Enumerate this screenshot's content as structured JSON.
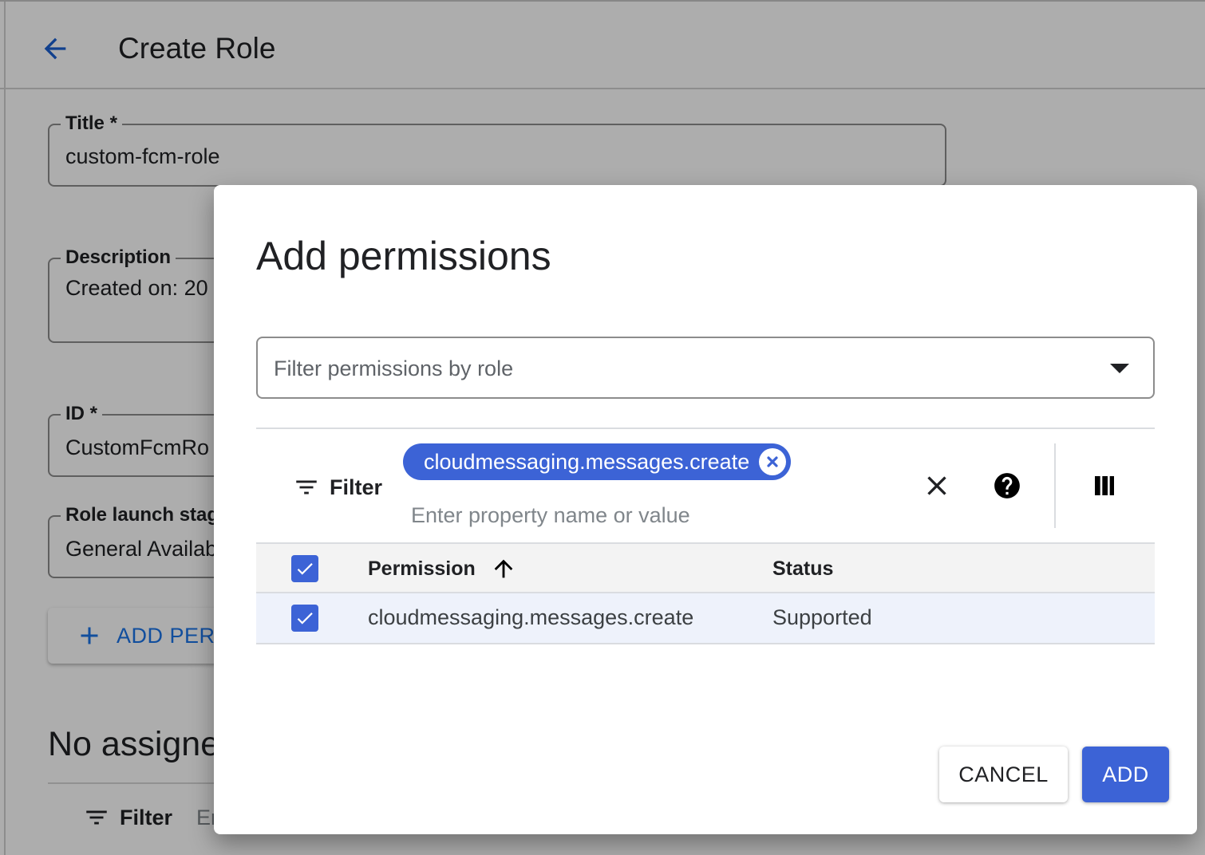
{
  "page": {
    "title": "Create Role",
    "fields": {
      "title": {
        "label": "Title *",
        "value": "custom-fcm-role"
      },
      "description": {
        "label": "Description",
        "value": "Created on: 20"
      },
      "id": {
        "label": "ID *",
        "value": "CustomFcmRo"
      },
      "launch_stage": {
        "label": "Role launch stag",
        "value": "General Availab"
      }
    },
    "add_permissions_label": "ADD PERI",
    "no_assigned_heading": "No assigne",
    "filter": {
      "label": "Filter",
      "placeholder": "Er"
    }
  },
  "dialog": {
    "title": "Add permissions",
    "role_filter_placeholder": "Filter permissions by role",
    "filterbar": {
      "label": "Filter",
      "chip": "cloudmessaging.messages.create",
      "input_placeholder": "Enter property name or value"
    },
    "table": {
      "columns": {
        "permission": "Permission",
        "status": "Status"
      },
      "sort": "ascending",
      "rows": [
        {
          "permission": "cloudmessaging.messages.create",
          "status": "Supported",
          "checked": true
        }
      ],
      "header_checked": true
    },
    "buttons": {
      "cancel": "CANCEL",
      "add": "ADD"
    }
  },
  "colors": {
    "primary": "#3c63d6",
    "link": "#1a73e8",
    "row_selected": "#eef2fb",
    "scrim": "rgba(0,0,0,0.32)"
  },
  "icons": {
    "back": "arrow-back-icon",
    "filter": "filter-list-icon",
    "chip_remove": "cancel-circle-icon",
    "clear": "close-icon",
    "help": "help-icon",
    "columns": "view-column-icon",
    "sort": "arrow-upward-icon",
    "check": "check-icon",
    "dropdown": "arrow-drop-down-icon",
    "add": "plus-icon"
  }
}
